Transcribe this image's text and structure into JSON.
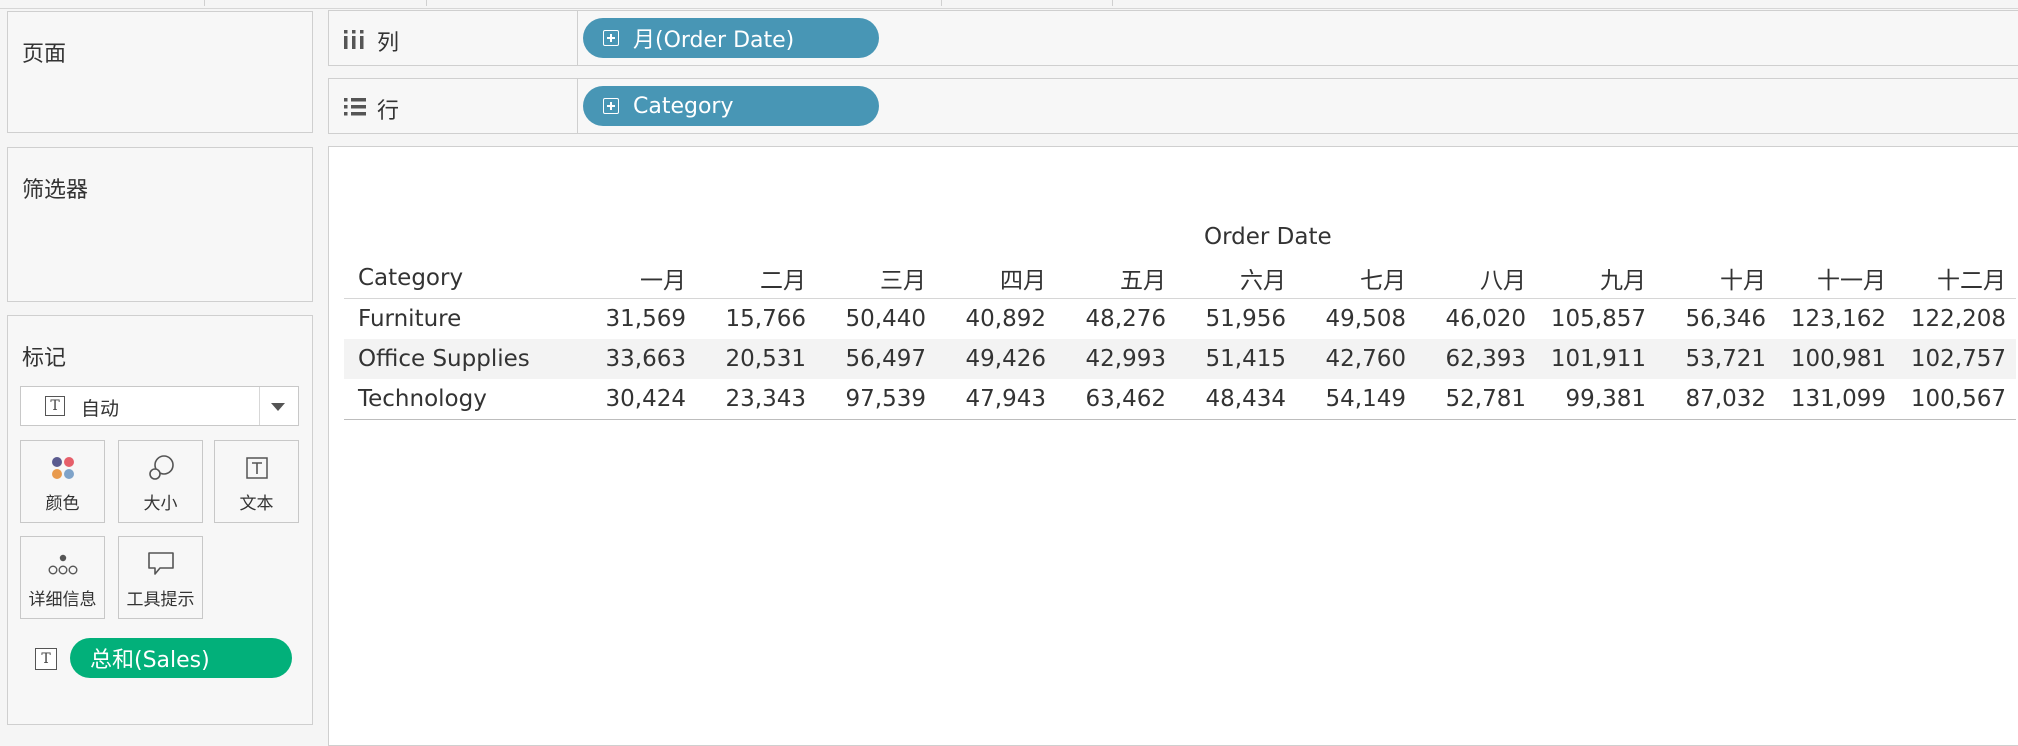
{
  "cards": {
    "pages_title": "页面",
    "filters_title": "筛选器",
    "marks_title": "标记"
  },
  "shelves": {
    "columns": {
      "label": "列",
      "pill": "月(Order Date)"
    },
    "rows": {
      "label": "行",
      "pill": "Category"
    }
  },
  "marks": {
    "type_selected": "自动",
    "buttons": {
      "color": "颜色",
      "size": "大小",
      "text": "文本",
      "detail": "详细信息",
      "tooltip": "工具提示"
    },
    "field_pill": "总和(Sales)",
    "icon_colors": [
      "#5b5b8f",
      "#e65f6a",
      "#e89a4e",
      "#7fa3c9"
    ]
  },
  "table": {
    "column_title": "Order Date",
    "row_header": "Category",
    "months": [
      "一月",
      "二月",
      "三月",
      "四月",
      "五月",
      "六月",
      "七月",
      "八月",
      "九月",
      "十月",
      "十一月",
      "十二月"
    ],
    "rows": [
      {
        "category": "Furniture",
        "values": [
          "31,569",
          "15,766",
          "50,440",
          "40,892",
          "48,276",
          "51,956",
          "49,508",
          "46,020",
          "105,857",
          "56,346",
          "123,162",
          "122,208"
        ]
      },
      {
        "category": "Office Supplies",
        "values": [
          "33,663",
          "20,531",
          "56,497",
          "49,426",
          "42,993",
          "51,415",
          "42,760",
          "62,393",
          "101,911",
          "53,721",
          "100,981",
          "102,757"
        ]
      },
      {
        "category": "Technology",
        "values": [
          "30,424",
          "23,343",
          "97,539",
          "47,943",
          "63,462",
          "48,434",
          "54,149",
          "52,781",
          "99,381",
          "87,032",
          "131,099",
          "100,567"
        ]
      }
    ]
  },
  "colors": {
    "dimension_pill": "#4896b5",
    "measure_pill": "#02b07a"
  }
}
